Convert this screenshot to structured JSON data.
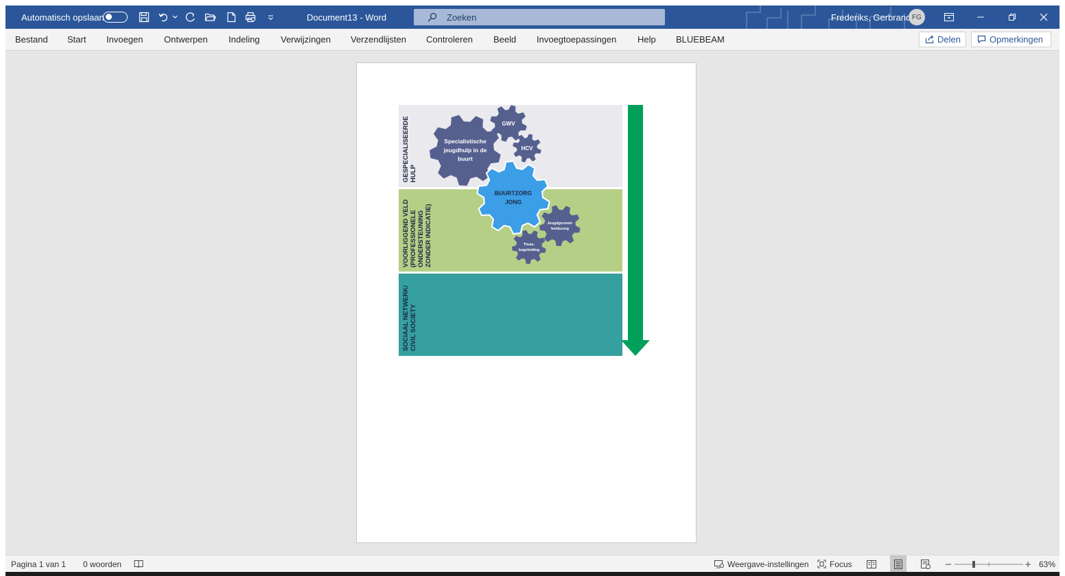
{
  "titlebar": {
    "autosave_label": "Automatisch opslaan",
    "doc_title": "Document13  -  Word",
    "search_placeholder": "Zoeken",
    "user_name": "Frederiks, Gerbrand",
    "user_initials": "FG",
    "color": "#2b579a"
  },
  "ribbon": {
    "tabs": [
      "Bestand",
      "Start",
      "Invoegen",
      "Ontwerpen",
      "Indeling",
      "Verwijzingen",
      "Verzendlijsten",
      "Controleren",
      "Beeld",
      "Invoegtoepassingen",
      "Help",
      "BLUEBEAM"
    ],
    "share_label": "Delen",
    "comments_label": "Opmerkingen"
  },
  "figure": {
    "rows": [
      {
        "label": "GESPECIALISEERDE\nHULP",
        "color": "#e9e9ee"
      },
      {
        "label": "VOORLIGGEND VELD\n(PROFESSIONELE\nONDERSTEUNING\nZONDER INDICATIE)",
        "color": "#b6cf87"
      },
      {
        "label": "SOCIAAL NETWERK/\nCIVIL SOCIETY",
        "color": "#35a09f"
      }
    ],
    "gears": {
      "specialist": [
        "Specialistische",
        "jeugdhulp in de",
        "buurt"
      ],
      "gwv": "GWV",
      "hcv": "HCV",
      "buurtzorg": [
        "BUURTZORG",
        "JONG"
      ],
      "jeugdgezond": [
        "Jeugdgezond-",
        "heidszorg"
      ],
      "thuis": [
        "Thuis-",
        "begeleiding"
      ]
    },
    "gear_color": "#56608f",
    "highlight_gear_color": "#3b9ee6",
    "arrow_color": "#00a05a"
  },
  "statusbar": {
    "page": "Pagina 1 van 1",
    "words": "0 woorden",
    "display_settings": "Weergave-instellingen",
    "focus": "Focus",
    "zoom": "63%"
  }
}
